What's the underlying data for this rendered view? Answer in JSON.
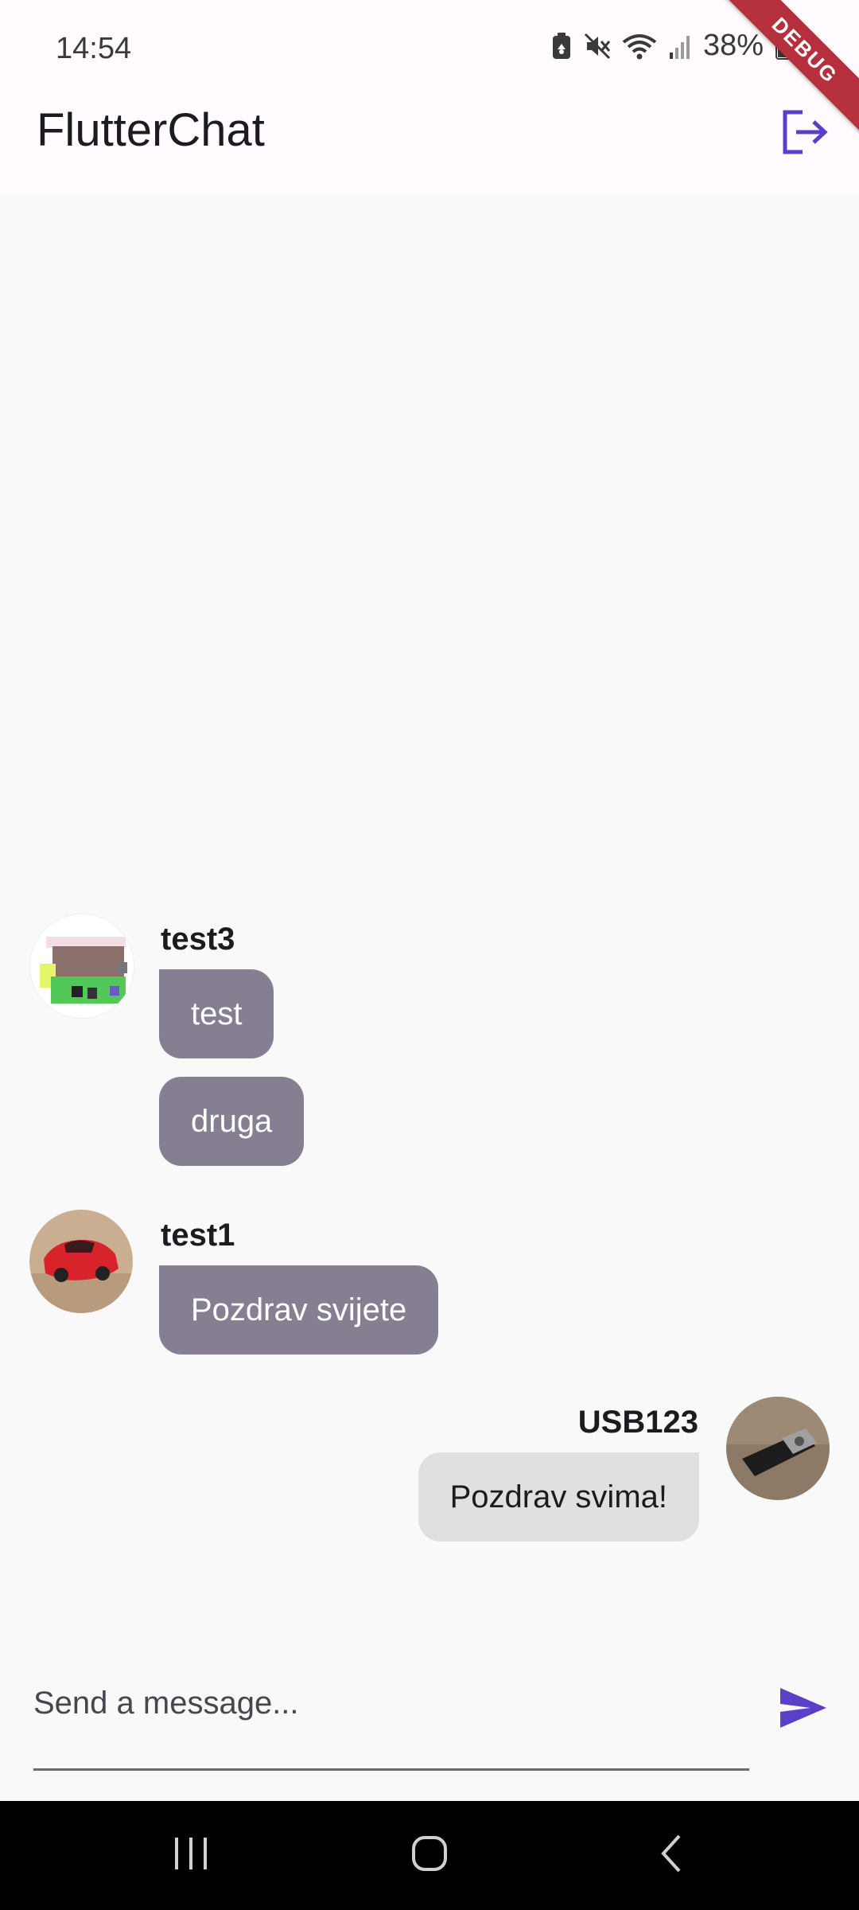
{
  "status_bar": {
    "time": "14:54",
    "battery": "38%",
    "icons": [
      "battery-saver-icon",
      "mute-icon",
      "wifi-icon",
      "signal-icon",
      "battery-icon"
    ],
    "debug_banner": "DEBUG"
  },
  "app_bar": {
    "title": "FlutterChat",
    "logout_icon": "logout-icon",
    "accent_color": "#5b3fc6"
  },
  "messages": [
    {
      "username": "test3",
      "text": "test",
      "side": "other"
    },
    {
      "username": "",
      "text": "druga",
      "side": "other"
    },
    {
      "username": "test1",
      "text": "Pozdrav svijete",
      "side": "other"
    },
    {
      "username": "USB123",
      "text": "Pozdrav svima!",
      "side": "mine"
    }
  ],
  "colors": {
    "other_bubble": "#867f92",
    "mine_bubble": "#e0e0e0",
    "background": "#f9f9f9"
  },
  "composer": {
    "placeholder": "Send a message...",
    "value": "",
    "send_icon": "send-icon"
  },
  "nav_bar": {
    "buttons": [
      "recents-icon",
      "home-icon",
      "back-icon"
    ]
  }
}
